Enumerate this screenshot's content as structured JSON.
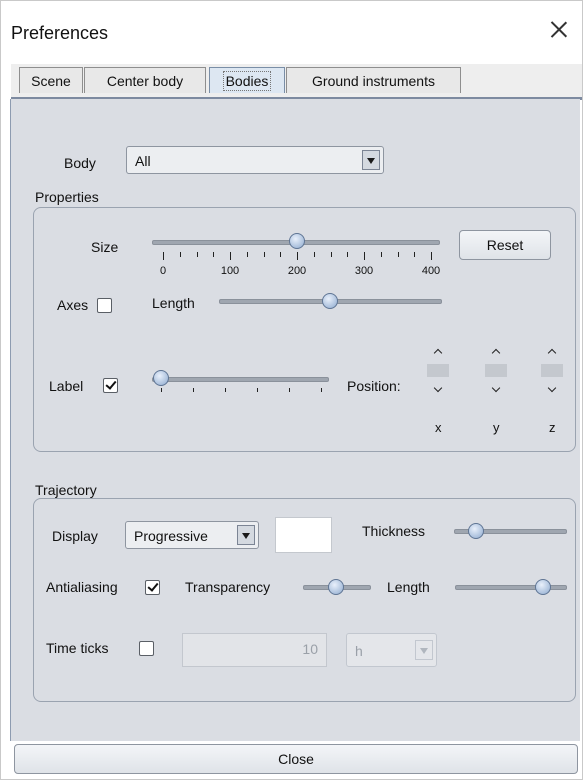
{
  "window": {
    "title": "Preferences"
  },
  "tabs": [
    {
      "label": "Scene",
      "active": false
    },
    {
      "label": "Center body",
      "active": false
    },
    {
      "label": "Bodies",
      "active": true
    },
    {
      "label": "Ground instruments",
      "active": false
    }
  ],
  "body": {
    "label": "Body",
    "selected": "All"
  },
  "properties": {
    "title": "Properties",
    "size": {
      "label": "Size",
      "ticks": [
        "0",
        "100",
        "200",
        "300",
        "400"
      ],
      "min": 0,
      "max": 400,
      "value": 200
    },
    "reset_label": "Reset",
    "axes": {
      "label": "Axes",
      "checked": false,
      "length_label": "Length",
      "length_value_fraction": 0.5
    },
    "label": {
      "label": "Label",
      "checked": true,
      "slider_value_fraction": 0.0
    },
    "position": {
      "label": "Position:",
      "axes": [
        "x",
        "y",
        "z"
      ]
    }
  },
  "trajectory": {
    "title": "Trajectory",
    "display": {
      "label": "Display",
      "selected": "Progressive",
      "color": "#ffffff"
    },
    "thickness": {
      "label": "Thickness",
      "value_fraction": 0.15
    },
    "antialiasing": {
      "label": "Antialiasing",
      "checked": true
    },
    "transparency": {
      "label": "Transparency",
      "value_fraction": 0.5
    },
    "length": {
      "label": "Length",
      "value_fraction": 0.85
    },
    "time_ticks": {
      "label": "Time ticks",
      "checked": false,
      "value": "10",
      "unit": "h"
    }
  },
  "close_label": "Close"
}
